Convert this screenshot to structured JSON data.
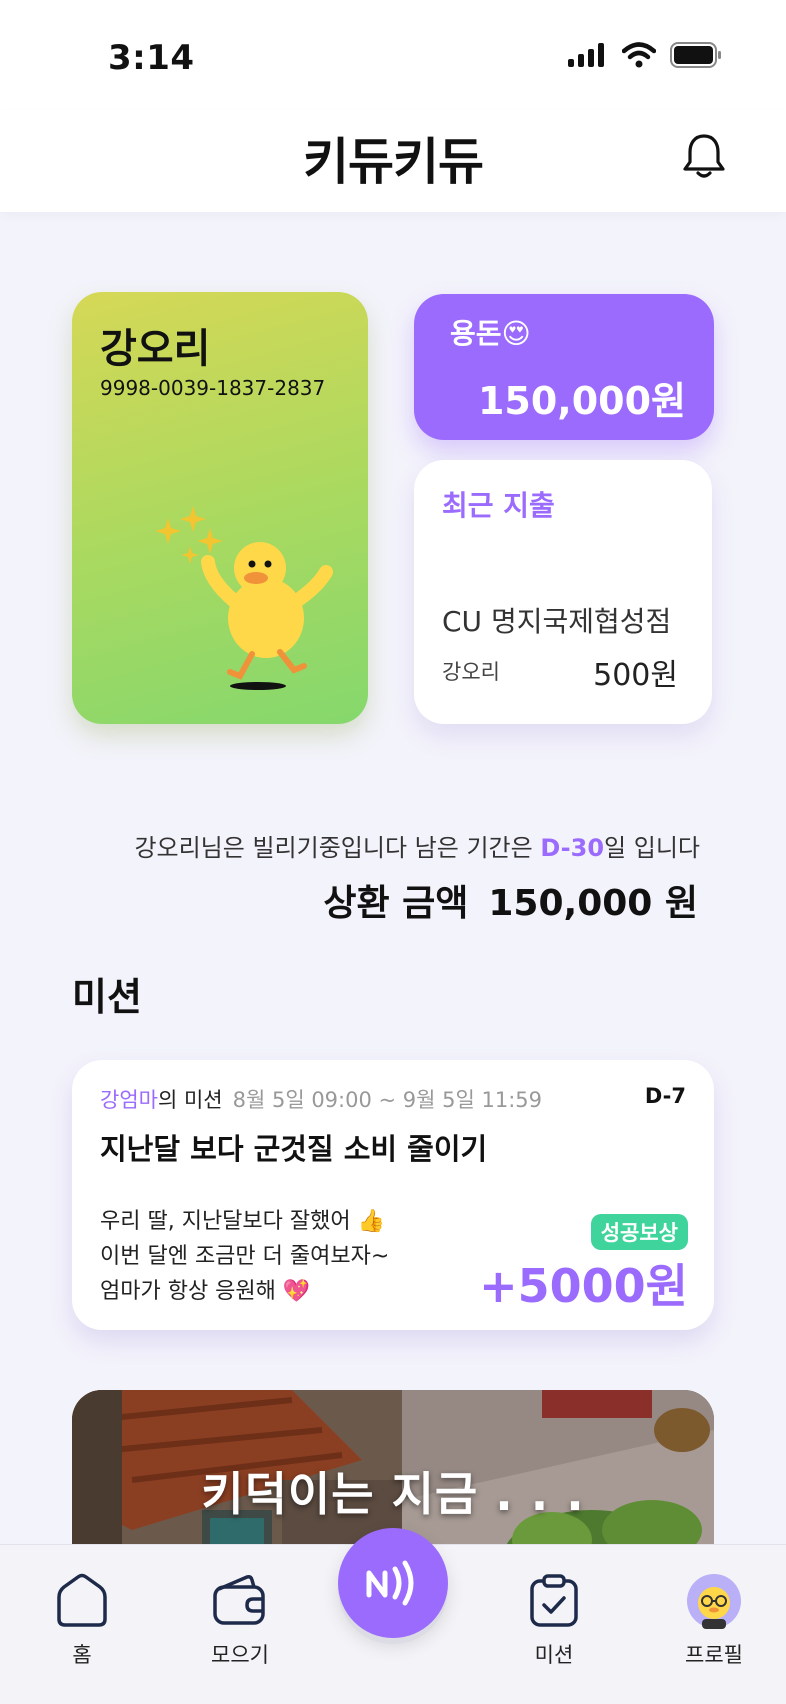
{
  "status_bar": {
    "time": "3:14"
  },
  "header": {
    "logo": "키듀키듀"
  },
  "account": {
    "name": "강오리",
    "number": "9998-0039-1837-2837"
  },
  "allowance": {
    "label": "용돈😍",
    "amount": "150,000원"
  },
  "recent_spend": {
    "title": "최근 지출",
    "store": "CU 명지국제협성점",
    "user": "강오리",
    "amount": "500원"
  },
  "loan": {
    "text_prefix": "강오리님은 빌리기중입니다 남은 기간은 ",
    "dday": "D-30",
    "text_suffix": "일 입니다",
    "repay_label": "상환 금액",
    "repay_amount": "150,000 원"
  },
  "mission_section": {
    "title": "미션"
  },
  "mission": {
    "from": "강엄마",
    "from_suffix": "의 미션",
    "period": "8월 5일 09:00 ~ 9월 5일 11:59",
    "dday": "D-7",
    "title": "지난달 보다 군것질 소비 줄이기",
    "message_1": "우리 딸, 지난달보다 잘했어 👍",
    "message_2": "이번 달엔 조금만 더 줄여보자~",
    "message_3": "엄마가 항상 응원해 💖",
    "badge": "성공보상",
    "reward": "+5000원"
  },
  "banner": {
    "title": "키덕이는 지금 . . ."
  },
  "tabbar": {
    "home": "홈",
    "wallet": "모으기",
    "mission": "미션",
    "profile": "프로필"
  },
  "colors": {
    "accent": "#9b6bfd",
    "success": "#3fd49b"
  }
}
